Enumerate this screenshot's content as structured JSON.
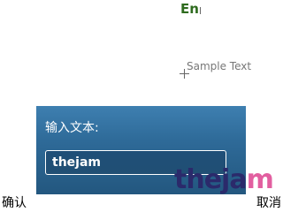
{
  "status": {
    "input_mode": "En"
  },
  "canvas": {
    "sample_text": "Sample Text"
  },
  "dialog": {
    "prompt": "输入文本:",
    "input_value": "thejam"
  },
  "watermark": {
    "part1": "theja",
    "part2": "m"
  },
  "softkeys": {
    "left": "确认",
    "right": "取消"
  }
}
